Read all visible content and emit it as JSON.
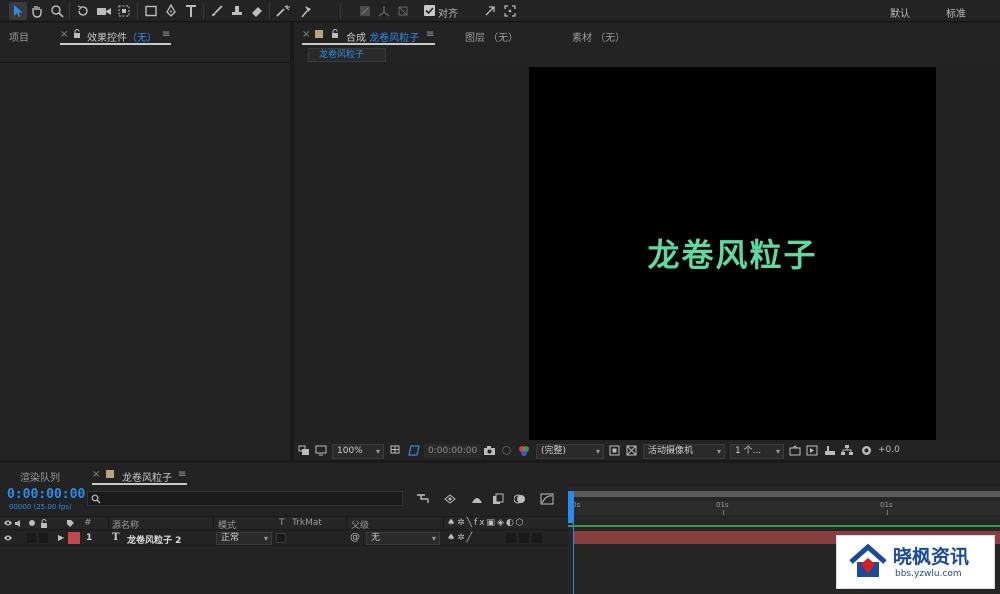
{
  "toolbar": {
    "align_label": "对齐",
    "workspace_default": "默认",
    "workspace_standard": "标准"
  },
  "project_panel": {
    "tab_project": "项目",
    "tab_effects_prefix": "效果控件",
    "tab_effects_value": "（无）"
  },
  "comp_panel": {
    "tab_comp_prefix": "合成",
    "tab_comp_name": "龙卷风粒子",
    "tab_layer": "图层 （无）",
    "tab_footage": "素材 （无）",
    "breadcrumb": "龙卷风粒子",
    "canvas_text": "龙卷风粒子",
    "canvas_text_color": "#5fd9a0",
    "zoom": "100%",
    "timecode": "0:00:00:00",
    "resolution": "(完整)",
    "camera": "活动摄像机",
    "views": "1 个...",
    "exposure": "+0.0"
  },
  "timeline": {
    "tab_render_queue": "渲染队列",
    "tab_comp": "龙卷风粒子",
    "timecode": "0:00:00:00",
    "frame_info": "00000 (25.00 fps)",
    "search_placeholder": "",
    "col_hash": "#",
    "col_source_name": "源名称",
    "col_mode": "模式",
    "col_t": "T",
    "col_trkmat": "TrkMat",
    "col_parent": "父级",
    "ruler_start": "0s",
    "ruler_mark1": "01s",
    "ruler_mark2": "01s",
    "layers": [
      {
        "number": "1",
        "type_icon": "T",
        "name": "龙卷风粒子 2",
        "mode": "正常",
        "parent": "无",
        "label_color": "#c04848"
      }
    ]
  },
  "watermark": {
    "title": "晓枫资讯",
    "url": "bbs.yzwlu.com"
  },
  "colors": {
    "accent_blue": "#2d8ceb",
    "bar_red": "#8a3f3f",
    "green_line": "#2e9a4a"
  }
}
